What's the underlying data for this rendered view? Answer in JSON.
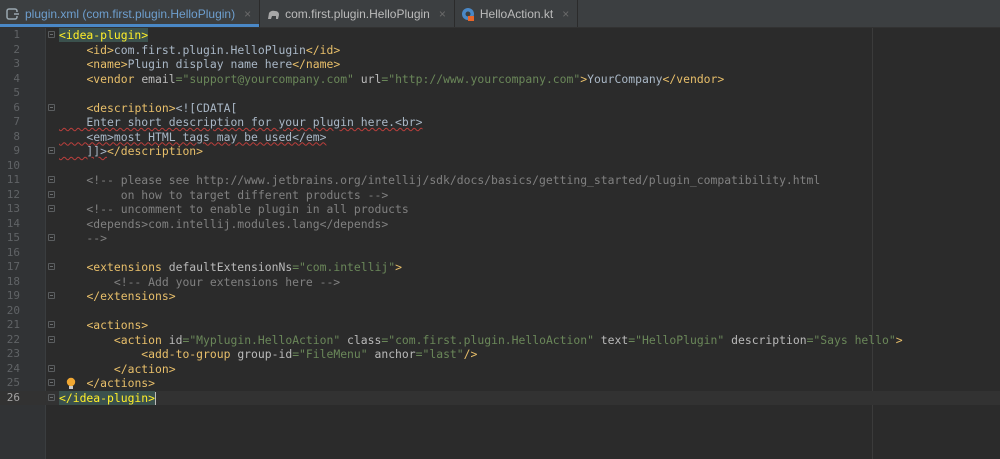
{
  "tabs": [
    {
      "label": "plugin.xml (com.first.plugin.HelloPlugin)",
      "icon": "xml-file-icon",
      "active": true
    },
    {
      "label": "com.first.plugin.HelloPlugin",
      "icon": "gradle-elephant-icon",
      "active": false
    },
    {
      "label": "HelloAction.kt",
      "icon": "kotlin-file-icon",
      "active": false
    }
  ],
  "close_glyph": "×",
  "colors": {
    "tag": "#e8bf6a",
    "attr": "#bababa",
    "value": "#6a8759",
    "text": "#a9b7c6",
    "comment": "#808080",
    "background": "#2b2b2b"
  },
  "lines": [
    {
      "n": "1",
      "tokens": [
        [
          "t",
          "<idea-plugin>"
        ]
      ]
    },
    {
      "n": "2",
      "tokens": [
        [
          "x",
          "    "
        ],
        [
          "t",
          "<id>"
        ],
        [
          "x",
          "com.first.plugin.HelloPlugin"
        ],
        [
          "t",
          "</id>"
        ]
      ]
    },
    {
      "n": "3",
      "tokens": [
        [
          "x",
          "    "
        ],
        [
          "t",
          "<name>"
        ],
        [
          "x",
          "Plugin display name here"
        ],
        [
          "t",
          "</name>"
        ]
      ]
    },
    {
      "n": "4",
      "tokens": [
        [
          "x",
          "    "
        ],
        [
          "t",
          "<vendor "
        ],
        [
          "a",
          "email"
        ],
        [
          "v",
          "=\"support@yourcompany.com\""
        ],
        [
          "a",
          " url"
        ],
        [
          "v",
          "=\"http://www.yourcompany.com\""
        ],
        [
          "t",
          ">"
        ],
        [
          "x",
          "YourCompany"
        ],
        [
          "t",
          "</vendor>"
        ]
      ]
    },
    {
      "n": "5",
      "tokens": []
    },
    {
      "n": "6",
      "tokens": [
        [
          "x",
          "    "
        ],
        [
          "t",
          "<description>"
        ],
        [
          "x",
          "<![CDATA["
        ]
      ]
    },
    {
      "n": "7",
      "tokens": [
        [
          "x",
          "    Enter short description for your plugin here.<br>"
        ]
      ]
    },
    {
      "n": "8",
      "tokens": [
        [
          "x",
          "    <em>most HTML tags may be used</em>"
        ]
      ]
    },
    {
      "n": "9",
      "tokens": [
        [
          "x",
          "    ]]>"
        ],
        [
          "t",
          "</description>"
        ]
      ]
    },
    {
      "n": "10",
      "tokens": []
    },
    {
      "n": "11",
      "tokens": [
        [
          "c",
          "    <!-- please see http://www.jetbrains.org/intellij/sdk/docs/basics/getting_started/plugin_compatibility.html"
        ]
      ]
    },
    {
      "n": "12",
      "tokens": [
        [
          "c",
          "         on how to target different products -->"
        ]
      ]
    },
    {
      "n": "13",
      "tokens": [
        [
          "c",
          "    <!-- uncomment to enable plugin in all products"
        ]
      ]
    },
    {
      "n": "14",
      "tokens": [
        [
          "c",
          "    <depends>com.intellij.modules.lang</depends>"
        ]
      ]
    },
    {
      "n": "15",
      "tokens": [
        [
          "c",
          "    -->"
        ]
      ]
    },
    {
      "n": "16",
      "tokens": []
    },
    {
      "n": "17",
      "tokens": [
        [
          "x",
          "    "
        ],
        [
          "t",
          "<extensions "
        ],
        [
          "a",
          "defaultExtensionNs"
        ],
        [
          "v",
          "=\"com.intellij\""
        ],
        [
          "t",
          ">"
        ]
      ]
    },
    {
      "n": "18",
      "tokens": [
        [
          "c",
          "        <!-- Add your extensions here -->"
        ]
      ]
    },
    {
      "n": "19",
      "tokens": [
        [
          "x",
          "    "
        ],
        [
          "t",
          "</extensions>"
        ]
      ]
    },
    {
      "n": "20",
      "tokens": []
    },
    {
      "n": "21",
      "tokens": [
        [
          "x",
          "    "
        ],
        [
          "t",
          "<actions>"
        ]
      ]
    },
    {
      "n": "22",
      "tokens": [
        [
          "x",
          "        "
        ],
        [
          "t",
          "<action "
        ],
        [
          "a",
          "id"
        ],
        [
          "v",
          "=\"Myplugin.HelloAction\""
        ],
        [
          "a",
          " class"
        ],
        [
          "v",
          "=\"com.first.plugin.HelloAction\""
        ],
        [
          "a",
          " text"
        ],
        [
          "v",
          "=\"HelloPlugin\""
        ],
        [
          "a",
          " description"
        ],
        [
          "v",
          "=\"Says hello\""
        ],
        [
          "t",
          ">"
        ]
      ]
    },
    {
      "n": "23",
      "tokens": [
        [
          "x",
          "            "
        ],
        [
          "t",
          "<add-to-group "
        ],
        [
          "a",
          "group-id"
        ],
        [
          "v",
          "=\"FileMenu\""
        ],
        [
          "a",
          " anchor"
        ],
        [
          "v",
          "=\"last\""
        ],
        [
          "t",
          "/>"
        ]
      ]
    },
    {
      "n": "24",
      "tokens": [
        [
          "x",
          "        "
        ],
        [
          "t",
          "</action>"
        ]
      ]
    },
    {
      "n": "25",
      "tokens": [
        [
          "x",
          "    "
        ],
        [
          "t",
          "</actions>"
        ]
      ]
    },
    {
      "n": "26",
      "tokens": [
        [
          "t",
          "</idea-plugin>"
        ]
      ]
    }
  ]
}
